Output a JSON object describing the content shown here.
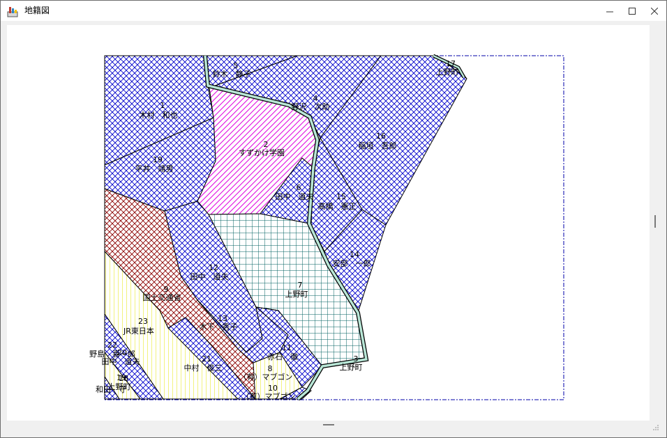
{
  "window": {
    "title": "地籍図",
    "icon": "map-app-icon",
    "buttons": {
      "minimize": "minimize-icon",
      "maximize": "maximize-icon",
      "close": "close-icon"
    }
  },
  "colors": {
    "parcel_blue": "#0000cc",
    "parcel_magenta": "#e000e0",
    "parcel_teal": "#006060",
    "parcel_red": "#8b0000",
    "parcel_yellow": "#e6e600",
    "road_fill": "#b8e6d6",
    "extent_border": "#0000aa"
  },
  "parcels": [
    {
      "id": "p1",
      "no": "1",
      "owner": "木村　和也"
    },
    {
      "id": "p2",
      "no": "2",
      "owner": "すずかけ学園"
    },
    {
      "id": "p3",
      "no": "3",
      "owner": "上野町"
    },
    {
      "id": "p4",
      "no": "4",
      "owner": "野沢　次助"
    },
    {
      "id": "p5",
      "no": "5",
      "owner": "鈴木　静子"
    },
    {
      "id": "p6",
      "no": "6",
      "owner": "田中　道夫"
    },
    {
      "id": "p7",
      "no": "7",
      "owner": "上野町"
    },
    {
      "id": "p8",
      "no": "8",
      "owner": "（有）マブゴン"
    },
    {
      "id": "p9",
      "no": "9",
      "owner": "国土交通省"
    },
    {
      "id": "p10",
      "no": "10",
      "owner": "（有）マブゴン"
    },
    {
      "id": "p11",
      "no": "11",
      "owner": "赤石　徹"
    },
    {
      "id": "p12",
      "no": "12",
      "owner": "田中　道夫"
    },
    {
      "id": "p13",
      "no": "13",
      "owner": "木下　秀子"
    },
    {
      "id": "p14",
      "no": "14",
      "owner": "安部　一郎"
    },
    {
      "id": "p15",
      "no": "15",
      "owner": "高橋　憲正"
    },
    {
      "id": "p16",
      "no": "16",
      "owner": "稲垣　吾郎"
    },
    {
      "id": "p17",
      "no": "17",
      "owner": "上野町"
    },
    {
      "id": "p18",
      "no": "18",
      "owner": "上野町"
    },
    {
      "id": "p19",
      "no": "19",
      "owner": "平井　靖男"
    },
    {
      "id": "p20",
      "no": "20",
      "owner": "田中　道夫"
    },
    {
      "id": "p21",
      "no": "21",
      "owner": "中村　俊三"
    },
    {
      "id": "p22",
      "no": "22",
      "owner": "野島　喜一郎"
    },
    {
      "id": "p23",
      "no": "23",
      "owner": "JR東日本"
    },
    {
      "id": "p24",
      "no": "19",
      "owner": "和田　守"
    }
  ]
}
